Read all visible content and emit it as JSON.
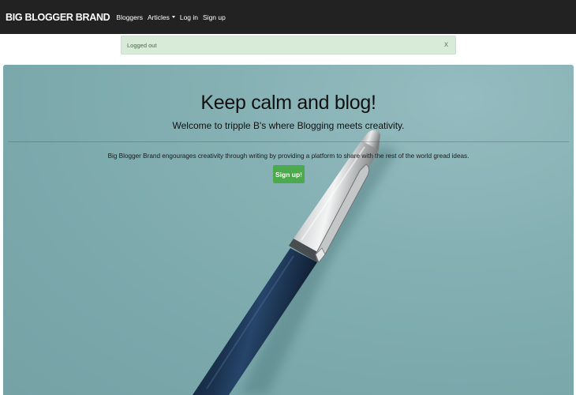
{
  "navbar": {
    "brand": "BIG BLOGGER BRAND",
    "links": [
      {
        "label": "Bloggers"
      },
      {
        "label": "Articles"
      },
      {
        "label": "Log in"
      },
      {
        "label": "Sign up"
      }
    ]
  },
  "alert": {
    "message": "Logged out",
    "close": "x"
  },
  "hero": {
    "title": "Keep calm and blog!",
    "subtitle": "Welcome to tripple B's where Blogging meets creativity.",
    "lead": "Big Blogger Brand engourages creativity through writing by providing a platform to share with the rest of the world gread ideas.",
    "button": "Sign up!"
  },
  "colors": {
    "navbar_bg": "#222222",
    "alert_bg": "#d8ead8",
    "hero_bg": "#86b1b4",
    "button_bg": "#4caa4c"
  }
}
